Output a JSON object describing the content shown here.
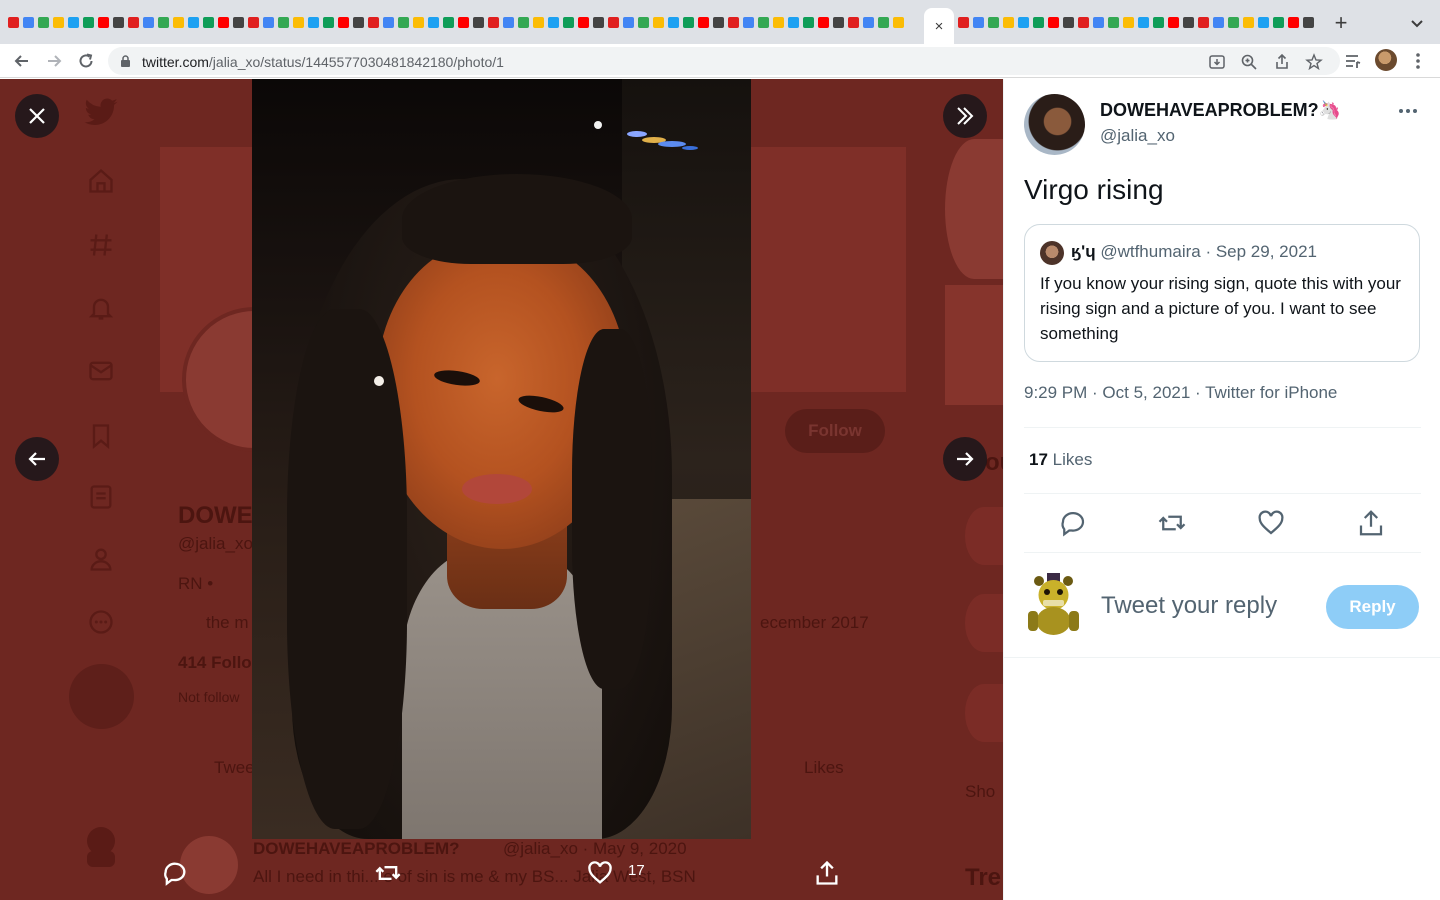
{
  "browser": {
    "active_tab_close": "×",
    "new_tab": "+",
    "url_host": "twitter.com",
    "url_path": "/jalia_xo/status/1445577030481842180/photo/1",
    "favicon_colors": [
      "#e02020",
      "#4285f4",
      "#34a853",
      "#fbbc05",
      "#1da1f2",
      "#0f9d58",
      "#ff0000",
      "#444"
    ]
  },
  "viewer": {
    "background_profile": {
      "name_fragment": "DOWE",
      "handle_fragment": "@jalia_xo",
      "bio_fragment": "RN •",
      "location_fragment": "the m",
      "joined_fragment": "ecember 2017",
      "followers_fragment": "414 Follo",
      "not_following_fragment": "Not follow",
      "follow_label": "Follow",
      "tab_tweets_fragment": "Twee",
      "tab_likes": "Likes",
      "show_fragment": "Sho",
      "trends_fragment": "Tre",
      "you_fragment": "ou",
      "pinned_tweet_author": "DOWEHAVEAPROBLEM?",
      "pinned_tweet_handle_date": "@jalia_xo · May 9, 2020",
      "pinned_tweet_text": "All I need in thi... e of sin is me & my BS... Jalia West, BSN"
    },
    "like_count": "17"
  },
  "tweet": {
    "display_name": "DOWEHAVEAPROBLEM?🦄",
    "handle": "@jalia_xo",
    "text": "Virgo rising",
    "quote": {
      "name": "ӄʹɥ",
      "handle_date": "@wtfhumaira · Sep 29, 2021",
      "text": "If you know your rising sign, quote this with your rising sign and a picture of you. I want to see something"
    },
    "meta": "9:29 PM · Oct 5, 2021 · Twitter for iPhone",
    "likes_count": "17",
    "likes_label": "Likes",
    "reply_placeholder": "Tweet your reply",
    "reply_button": "Reply"
  }
}
